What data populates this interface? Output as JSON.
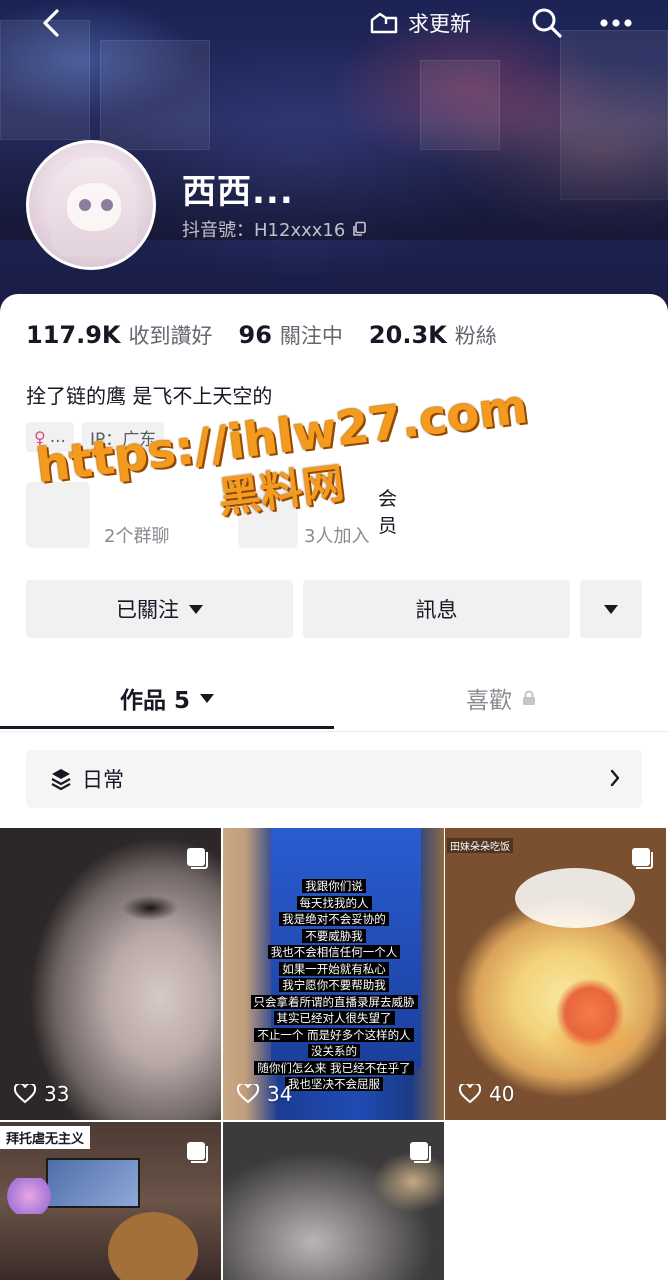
{
  "header": {
    "update_label": "求更新",
    "username": "西西...",
    "douyin_id": "抖音號：H12xxx16"
  },
  "stats": [
    {
      "value": "117.9K",
      "label": "收到讚好"
    },
    {
      "value": "96",
      "label": "關注中"
    },
    {
      "value": "20.3K",
      "label": "粉絲"
    }
  ],
  "bio": "拴了链的鹰 是飞不上天空的",
  "tags": {
    "gender_text": "...",
    "ip": "IP：广东"
  },
  "groups": {
    "group1_sub": "2个群聊",
    "group2_title": "会员",
    "group2_sub": "3人加入"
  },
  "watermark": {
    "url": "https://ihlw27.com",
    "name": "黑料网"
  },
  "actions": {
    "follow": "已關注",
    "message": "訊息"
  },
  "tabs": {
    "works": "作品 5",
    "likes": "喜歡"
  },
  "collection": {
    "label": "日常"
  },
  "posts": [
    {
      "likes": "33"
    },
    {
      "likes": "34",
      "lines": [
        "我跟你们说",
        "每天找我的人",
        "我是绝对不会妥协的",
        "不要威胁我",
        "我也不会相信任何一个人",
        "如果一开始就有私心",
        "我宁愿你不要帮助我",
        "只会拿着所谓的直播录屏去威胁",
        "其实已经对人很失望了",
        "不止一个 而是好多个这样的人",
        "没关系的",
        "随你们怎么来 我已经不在乎了",
        "我也坚决不会屈服"
      ]
    },
    {
      "likes": "40",
      "caption": "田妹朵朵吃饭"
    },
    {
      "title": "拜托虐无主义"
    },
    {}
  ],
  "colors": {
    "accent_text": "#161823",
    "secondary_text": "#646670",
    "button_bg": "#f1f1f2",
    "watermark": "#f39a1f"
  }
}
